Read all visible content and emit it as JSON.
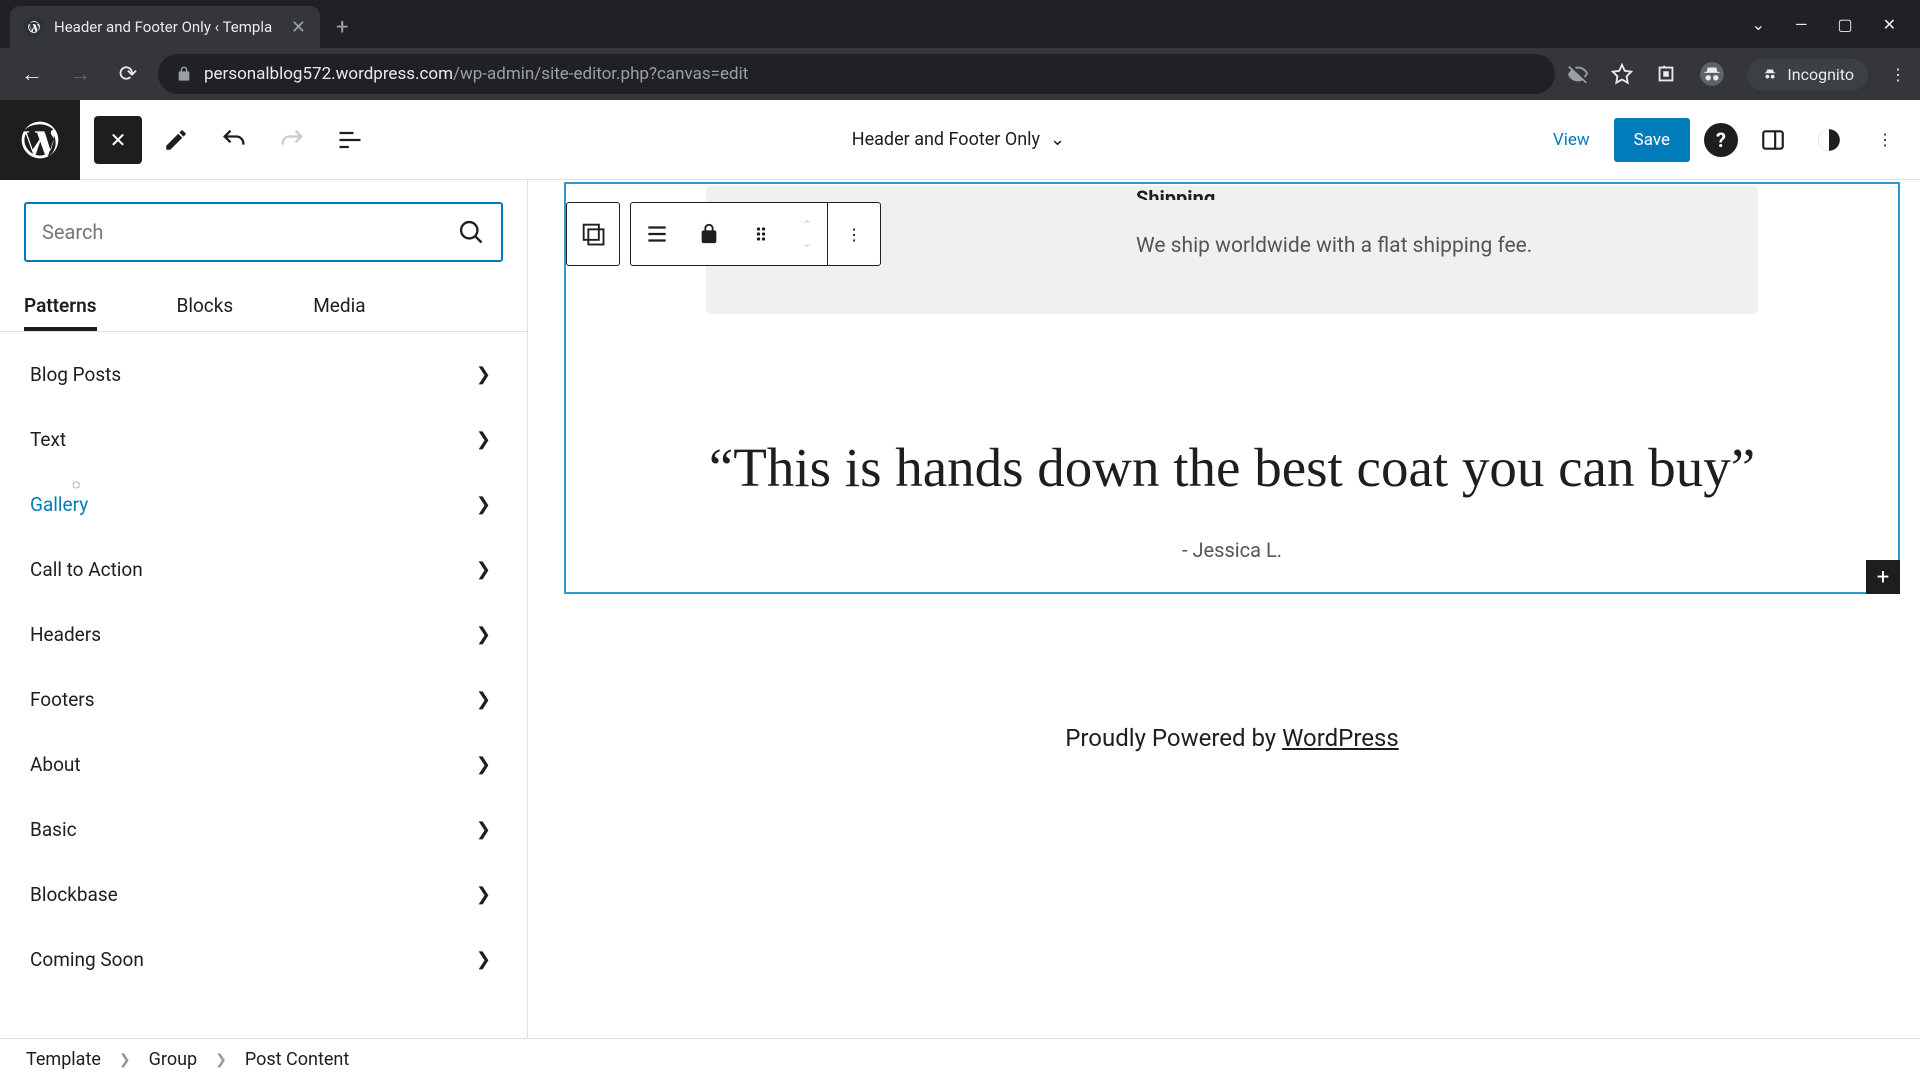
{
  "browser": {
    "tab_title": "Header and Footer Only ‹ Templa",
    "url_domain": "personalblog572.wordpress.com",
    "url_path": "/wp-admin/site-editor.php?canvas=edit",
    "incognito_label": "Incognito"
  },
  "editor": {
    "document_title": "Header and Footer Only",
    "view_label": "View",
    "save_label": "Save"
  },
  "inserter": {
    "search_placeholder": "Search",
    "tabs": {
      "patterns": "Patterns",
      "blocks": "Blocks",
      "media": "Media"
    },
    "categories": [
      "Blog Posts",
      "Text",
      "Gallery",
      "Call to Action",
      "Headers",
      "Footers",
      "About",
      "Basic",
      "Blockbase",
      "Coming Soon"
    ],
    "hovered_index": 2
  },
  "content": {
    "shipping_title": "Shipping",
    "shipping_body": "We ship worldwide with a flat shipping fee.",
    "quote": "“This is hands down the best coat you can buy”",
    "quote_author": "- Jessica L.",
    "footer_prefix": "Proudly Powered by ",
    "footer_link": "WordPress"
  },
  "breadcrumbs": [
    "Template",
    "Group",
    "Post Content"
  ]
}
